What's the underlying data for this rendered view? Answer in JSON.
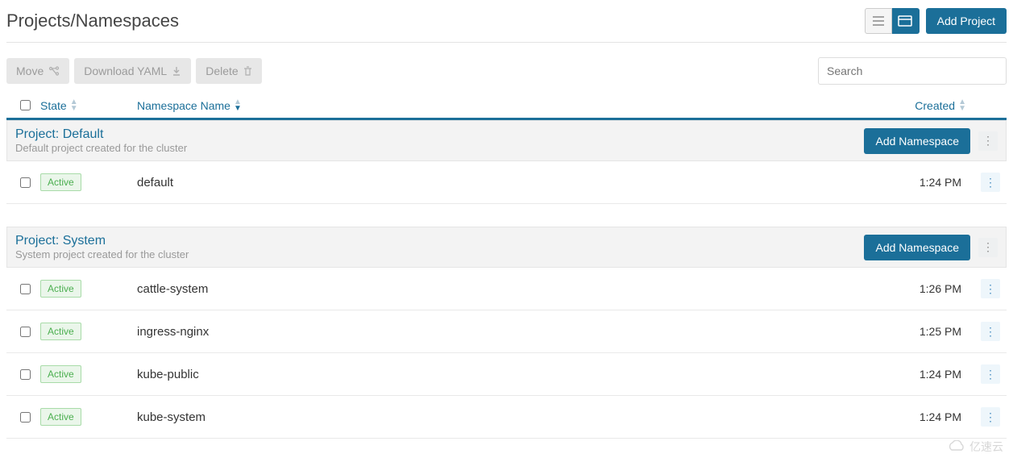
{
  "page": {
    "title": "Projects/Namespaces",
    "add_project_label": "Add Project"
  },
  "toolbar": {
    "move_label": "Move",
    "download_yaml_label": "Download YAML",
    "delete_label": "Delete"
  },
  "search": {
    "placeholder": "Search"
  },
  "columns": {
    "state": "State",
    "name": "Namespace Name",
    "created": "Created"
  },
  "add_namespace_label": "Add Namespace",
  "state_active_label": "Active",
  "projects": [
    {
      "title": "Project: Default",
      "subtitle": "Default project created for the cluster",
      "namespaces": [
        {
          "state": "active",
          "name": "default",
          "created": "1:24 PM"
        }
      ]
    },
    {
      "title": "Project: System",
      "subtitle": "System project created for the cluster",
      "namespaces": [
        {
          "state": "active",
          "name": "cattle-system",
          "created": "1:26 PM"
        },
        {
          "state": "active",
          "name": "ingress-nginx",
          "created": "1:25 PM"
        },
        {
          "state": "active",
          "name": "kube-public",
          "created": "1:24 PM"
        },
        {
          "state": "active",
          "name": "kube-system",
          "created": "1:24 PM"
        }
      ]
    }
  ],
  "watermark": "亿速云"
}
